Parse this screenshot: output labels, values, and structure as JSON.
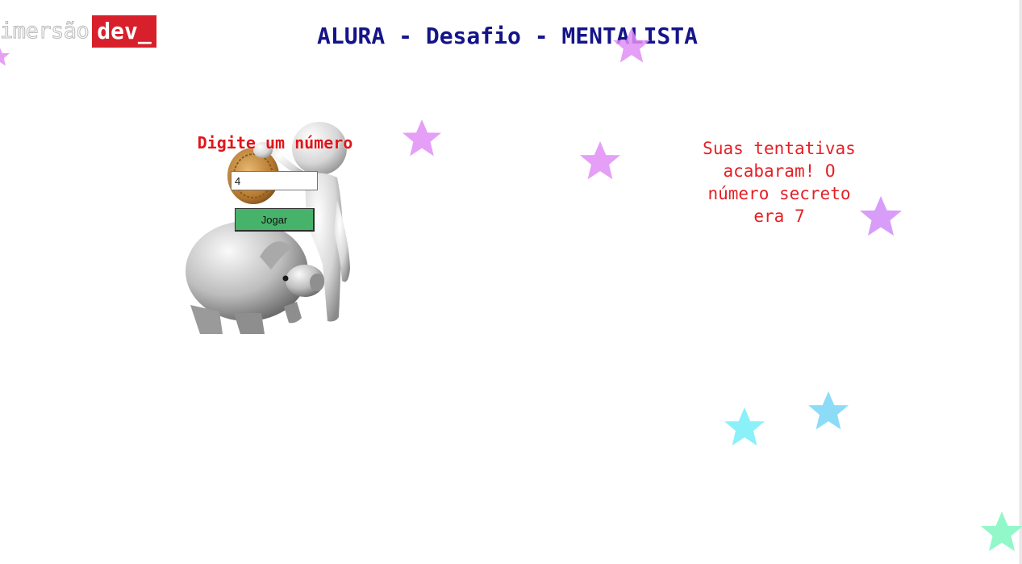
{
  "logo": {
    "text": "imersão",
    "badge": "dev_"
  },
  "header": {
    "title": "ALURA - Desafio - MENTALISTA"
  },
  "game": {
    "prompt": "Digite um número",
    "input_value": "4",
    "button_label": "Jogar"
  },
  "result": {
    "message": "Suas tentativas acabaram! O número secreto era 7"
  },
  "colors": {
    "title": "#14148a",
    "prompt": "#e0161c",
    "button": "#47b36a",
    "badge": "#d7202b",
    "star_violet": "#e08ef5",
    "star_purple": "#d08cf7",
    "star_cyan": "#7ef0f7",
    "star_skyblue": "#7fd8f6",
    "star_mint": "#86f7c4"
  },
  "icons": [
    "star-icon",
    "piggy-bank-illustration"
  ]
}
